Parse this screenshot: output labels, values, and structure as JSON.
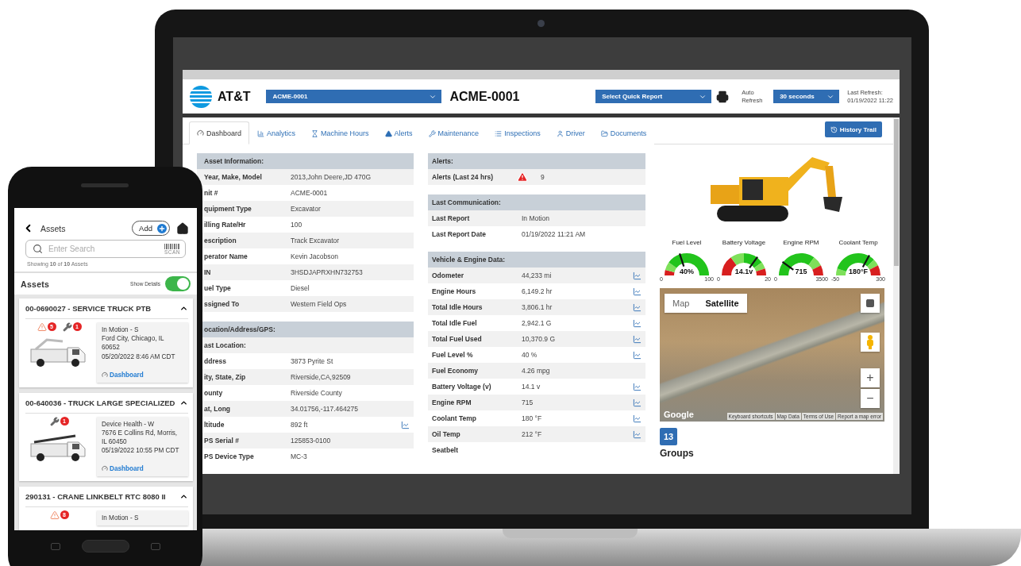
{
  "laptop": {
    "header": {
      "logo": "AT&T",
      "asset_select": "ACME-0001",
      "title": "ACME-0001",
      "quick_report": "Select Quick Report",
      "auto_refresh_label": "Auto Refresh",
      "refresh_select": "30 seconds",
      "last_refresh_label": "Last Refresh:",
      "last_refresh": "01/19/2022 11:22"
    },
    "tabs": [
      {
        "label": "Dashboard",
        "selected": true
      },
      {
        "label": "Analytics",
        "selected": false
      },
      {
        "label": "Machine Hours",
        "selected": false
      },
      {
        "label": "Alerts",
        "selected": false
      },
      {
        "label": "Maintenance",
        "selected": false
      },
      {
        "label": "Inspections",
        "selected": false
      },
      {
        "label": "Driver",
        "selected": false
      },
      {
        "label": "Documents",
        "selected": false
      }
    ],
    "history_button": "History Trail",
    "left_sections": [
      {
        "title": "Asset Information:",
        "rows": [
          {
            "label": "Year, Make, Model",
            "value": "2013,John Deere,JD 470G",
            "chart": false
          },
          {
            "label": "nit #",
            "value": "ACME-0001",
            "chart": false
          },
          {
            "label": "quipment Type",
            "value": "Excavator",
            "chart": false
          },
          {
            "label": "illing Rate/Hr",
            "value": "100",
            "chart": false
          },
          {
            "label": "escription",
            "value": "Track Excavator",
            "chart": false
          },
          {
            "label": "perator Name",
            "value": "Kevin Jacobson",
            "chart": false
          },
          {
            "label": "IN",
            "value": "3HSDJAPRXHN732753",
            "chart": false
          },
          {
            "label": "uel Type",
            "value": "Diesel",
            "chart": false
          },
          {
            "label": "ssigned To",
            "value": "Western Field Ops",
            "chart": false
          }
        ]
      },
      {
        "title": "ocation/Address/GPS:",
        "rows": [
          {
            "label": "ast Location:",
            "chart": false
          },
          {
            "label": "ddress",
            "value": "3873 Pyrite St",
            "chart": false
          },
          {
            "label": "ity, State, Zip",
            "value": "Riverside,CA,92509",
            "chart": false
          },
          {
            "label": "ounty",
            "value": "Riverside County",
            "chart": false
          },
          {
            "label": "at, Long",
            "value": "34.01756,-117.464275",
            "chart": false
          },
          {
            "label": "ltitude",
            "value": "892 ft",
            "chart": true
          },
          {
            "label": "PS Serial #",
            "value": "125853-0100",
            "chart": false
          },
          {
            "label": "PS Device Type",
            "value": "MC-3",
            "chart": false
          }
        ]
      }
    ],
    "middle_sections": [
      {
        "title": "Alerts:",
        "rows": [
          {
            "label": "Alerts (Last 24 hrs)",
            "value": "9",
            "warning": true,
            "chart": false
          }
        ]
      },
      {
        "title": "Last Communication:",
        "rows": [
          {
            "label": "Last Report",
            "value": "In Motion",
            "chart": false
          },
          {
            "label": "Last Report Date",
            "value": "01/19/2022 11:21 AM",
            "chart": false
          }
        ]
      },
      {
        "title": "Vehicle & Engine Data:",
        "rows": [
          {
            "label": "Odometer",
            "value": "44,233 mi",
            "chart": true
          },
          {
            "label": "Engine Hours",
            "value": "6,149.2 hr",
            "chart": true
          },
          {
            "label": "Total Idle Hours",
            "value": "3,806.1 hr",
            "chart": true
          },
          {
            "label": "Total Idle Fuel",
            "value": "2,942.1 G",
            "chart": true
          },
          {
            "label": "Total Fuel Used",
            "value": "10,370.9 G",
            "chart": true
          },
          {
            "label": "Fuel Level %",
            "value": "40 %",
            "chart": true
          },
          {
            "label": "Fuel Economy",
            "value": "4.26 mpg",
            "chart": false
          },
          {
            "label": "Battery Voltage (v)",
            "value": "14.1 v",
            "chart": true
          },
          {
            "label": "Engine RPM",
            "value": "715",
            "chart": true
          },
          {
            "label": "Coolant Temp",
            "value": "180 °F",
            "chart": true
          },
          {
            "label": "Oil Temp",
            "value": "212 °F",
            "chart": true
          },
          {
            "label": "Seatbelt",
            "chart": false
          }
        ]
      }
    ],
    "gauges": [
      {
        "label": "Fuel Level",
        "reading": "40%",
        "min": "0",
        "max": "100",
        "level": 0.4
      },
      {
        "label": "Battery Voltage",
        "reading": "14.1v",
        "min": "0",
        "max": "20",
        "level": 0.7
      },
      {
        "label": "Engine RPM",
        "reading": "715",
        "min": "0",
        "max": "3500",
        "level": 0.2
      },
      {
        "label": "Coolant Temp",
        "reading": "180°F",
        "min": "-50",
        "max": "300",
        "level": 0.66
      }
    ],
    "map": {
      "tabs": [
        {
          "label": "Map",
          "selected": false
        },
        {
          "label": "Satellite",
          "selected": true
        }
      ],
      "zoom_in": "+",
      "zoom_out": "−",
      "attribution": "Google",
      "footer_links": [
        "Keyboard shortcuts",
        "Map Data",
        "Terms of Use",
        "Report a map error"
      ]
    },
    "groups": {
      "count": "13",
      "label": "Groups"
    }
  },
  "phone": {
    "title": "Assets",
    "add_button": "Add",
    "search": {
      "placeholder": "Enter Search"
    },
    "scan": "SCAN",
    "showing": "Showing **10** of **10** Assets",
    "list_title": "Assets",
    "show_details": {
      "label": "Show Details",
      "on": true
    },
    "cards": [
      {
        "title": "00-0690027 - SERVICE TRUCK PTB",
        "expanded": true,
        "badges": [
          {
            "kind": "alert",
            "count": "5"
          },
          {
            "kind": "maintenance",
            "count": "1"
          }
        ],
        "status": "In Motion - S",
        "address": "Ford City, Chicago, IL 60652",
        "time": "05/20/2022 8:46 AM CDT",
        "link": "Dashboard",
        "kind": "truck"
      },
      {
        "title": "00-640036 - TRUCK LARGE SPECIALIZED",
        "expanded": true,
        "badges": [
          {
            "kind": "maintenance",
            "count": "1"
          }
        ],
        "status": "Device Health - W",
        "address": "7676 E Collins Rd, Morris, IL 60450",
        "time": "05/19/2022 10:55 PM CDT",
        "link": "Dashboard",
        "kind": "crane"
      },
      {
        "title": "290131 - CRANE LINKBELT RTC 8080 II",
        "expanded": true,
        "badges": [
          {
            "kind": "alert",
            "count": "8"
          }
        ],
        "status": "In Motion - S"
      }
    ]
  }
}
